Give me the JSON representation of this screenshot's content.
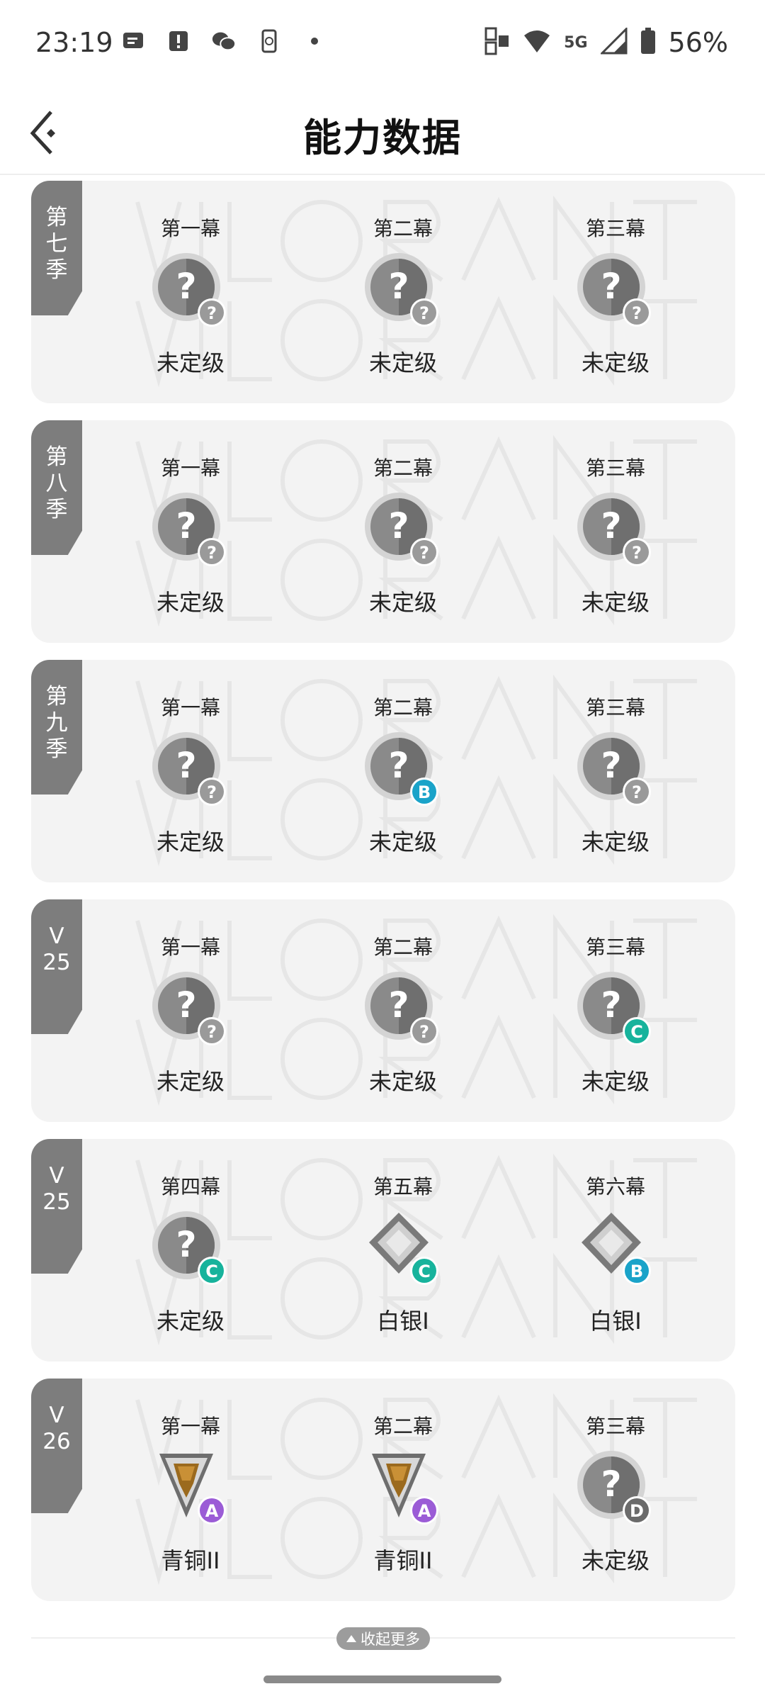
{
  "status_bar": {
    "time": "23:19",
    "network": "5G",
    "battery": "56%",
    "icons": [
      "message-icon",
      "alert-icon",
      "wechat-icon",
      "phone-sync-icon",
      "dot-icon",
      "hd-icon",
      "wifi-icon",
      "signal-icon",
      "battery-icon"
    ]
  },
  "header": {
    "title": "能力数据",
    "back_icon": "back-arrow-icon"
  },
  "seasons": [
    {
      "tag": "第七季",
      "acts": [
        {
          "title": "第一幕",
          "rank": "未定级",
          "emblem": "unranked",
          "badge": "?"
        },
        {
          "title": "第二幕",
          "rank": "未定级",
          "emblem": "unranked",
          "badge": "?"
        },
        {
          "title": "第三幕",
          "rank": "未定级",
          "emblem": "unranked",
          "badge": "?"
        }
      ]
    },
    {
      "tag": "第八季",
      "acts": [
        {
          "title": "第一幕",
          "rank": "未定级",
          "emblem": "unranked",
          "badge": "?"
        },
        {
          "title": "第二幕",
          "rank": "未定级",
          "emblem": "unranked",
          "badge": "?"
        },
        {
          "title": "第三幕",
          "rank": "未定级",
          "emblem": "unranked",
          "badge": "?"
        }
      ]
    },
    {
      "tag": "第九季",
      "acts": [
        {
          "title": "第一幕",
          "rank": "未定级",
          "emblem": "unranked",
          "badge": "?"
        },
        {
          "title": "第二幕",
          "rank": "未定级",
          "emblem": "unranked",
          "badge": "B"
        },
        {
          "title": "第三幕",
          "rank": "未定级",
          "emblem": "unranked",
          "badge": "?"
        }
      ]
    },
    {
      "tag": "V25",
      "acts": [
        {
          "title": "第一幕",
          "rank": "未定级",
          "emblem": "unranked",
          "badge": "?"
        },
        {
          "title": "第二幕",
          "rank": "未定级",
          "emblem": "unranked",
          "badge": "?"
        },
        {
          "title": "第三幕",
          "rank": "未定级",
          "emblem": "unranked",
          "badge": "C"
        }
      ]
    },
    {
      "tag": "V25",
      "acts": [
        {
          "title": "第四幕",
          "rank": "未定级",
          "emblem": "unranked",
          "badge": "C"
        },
        {
          "title": "第五幕",
          "rank": "白银I",
          "emblem": "silver",
          "badge": "C"
        },
        {
          "title": "第六幕",
          "rank": "白银I",
          "emblem": "silver",
          "badge": "B"
        }
      ]
    },
    {
      "tag": "V26",
      "acts": [
        {
          "title": "第一幕",
          "rank": "青铜II",
          "emblem": "bronze",
          "badge": "A"
        },
        {
          "title": "第二幕",
          "rank": "青铜II",
          "emblem": "bronze",
          "badge": "A"
        },
        {
          "title": "第三幕",
          "rank": "未定级",
          "emblem": "unranked",
          "badge": "D"
        }
      ]
    }
  ],
  "footer": {
    "collapse_label": "收起更多"
  },
  "colors": {
    "card_bg": "#f3f3f3",
    "tag_bg": "#7d7d7d",
    "badge_unknown": "#9a9a9a",
    "badge_A": "#9b5cd6",
    "badge_B": "#1aa3c9",
    "badge_C": "#17b39c",
    "badge_D": "#6b6b6b"
  }
}
